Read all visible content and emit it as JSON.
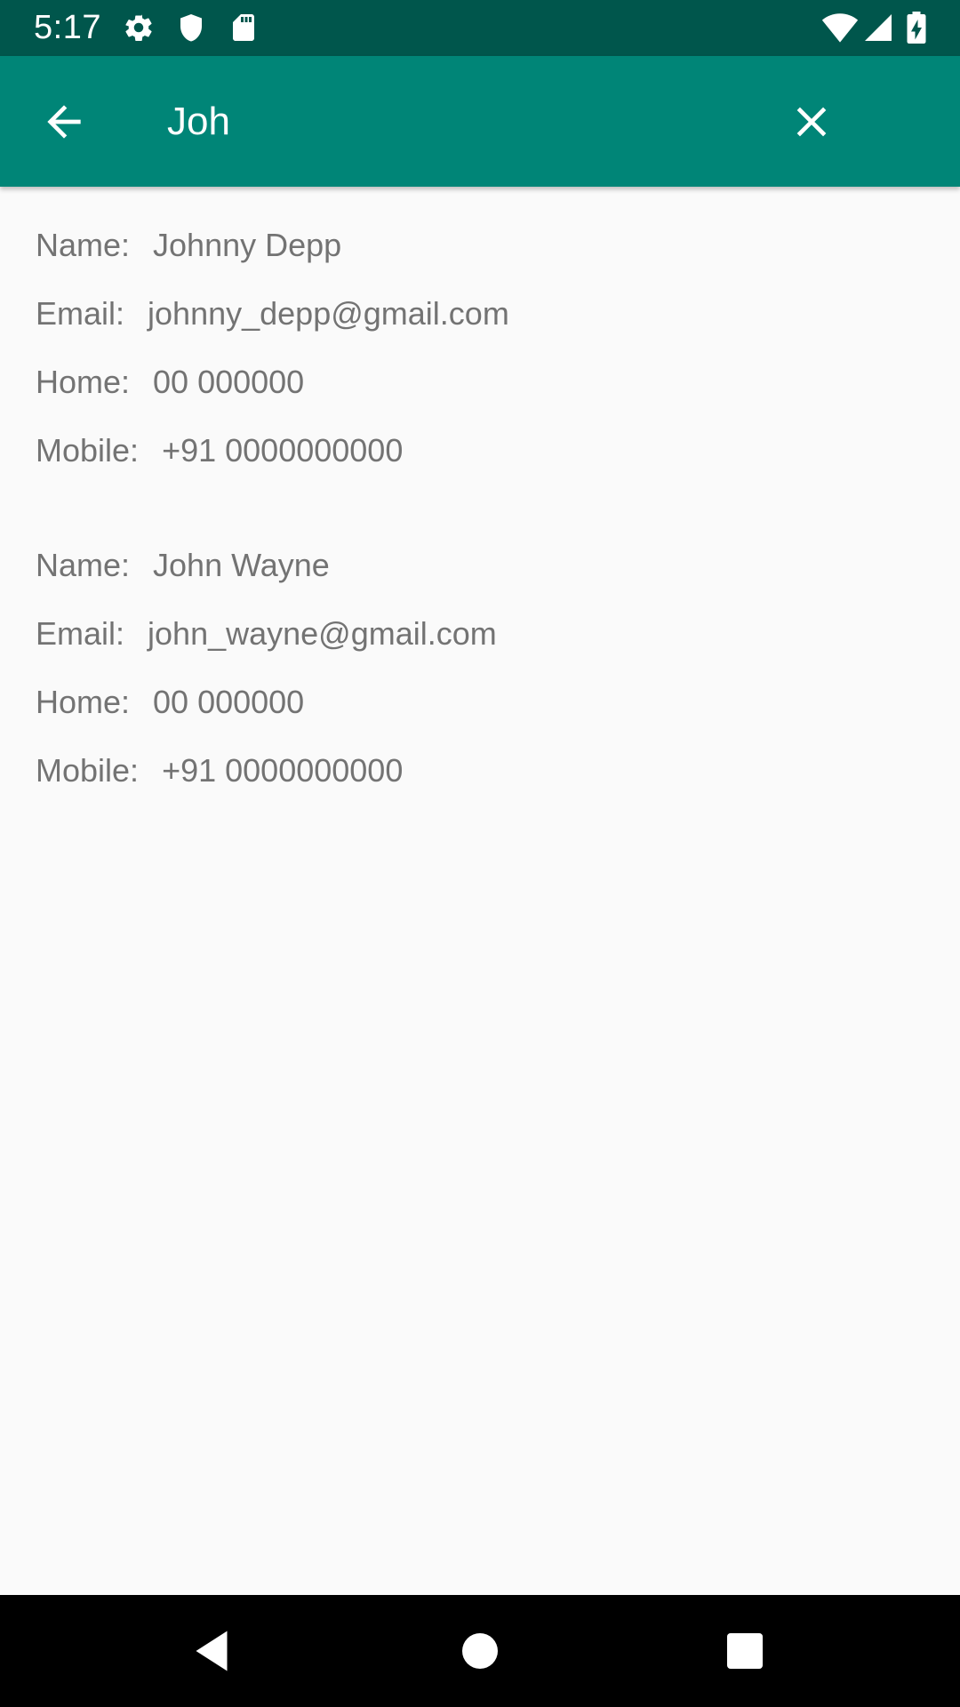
{
  "status_bar": {
    "time": "5:17",
    "icons": [
      "settings-icon",
      "shield-icon",
      "sd-card-icon",
      "wifi-icon",
      "cell-signal-icon",
      "battery-charging-icon"
    ]
  },
  "app_bar": {
    "search_value": "Joh",
    "back_icon": "arrow-back-icon",
    "clear_icon": "close-icon",
    "color": "#008577",
    "status_color": "#00564c"
  },
  "contacts": [
    {
      "name_label": "Name:",
      "name": "Johnny Depp",
      "email_label": "Email:",
      "email": "johnny_depp@gmail.com",
      "home_label": "Home:",
      "home": "00 000000",
      "mobile_label": "Mobile:",
      "mobile": "+91 0000000000"
    },
    {
      "name_label": "Name:",
      "name": "John Wayne",
      "email_label": "Email:",
      "email": "john_wayne@gmail.com",
      "home_label": "Home:",
      "home": "00 000000",
      "mobile_label": "Mobile:",
      "mobile": "+91 0000000000"
    }
  ],
  "nav_bar": {
    "icons": [
      "nav-back-icon",
      "nav-home-icon",
      "nav-recents-icon"
    ]
  }
}
